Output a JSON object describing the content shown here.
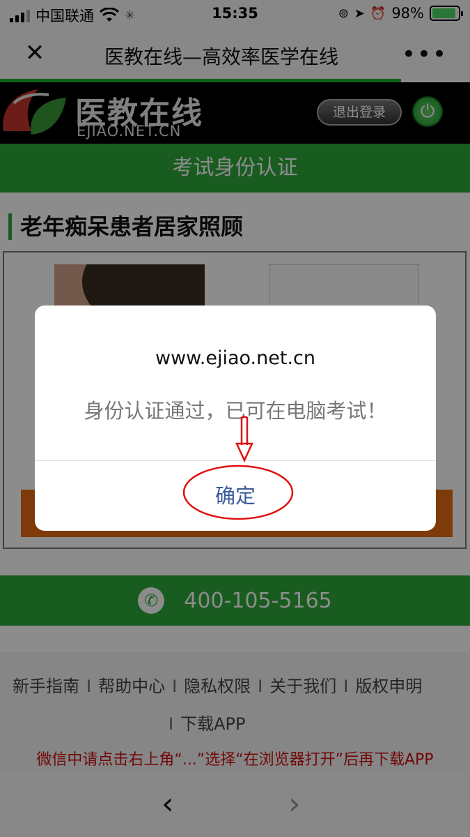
{
  "status_bar": {
    "carrier": "中国联通",
    "time": "15:35",
    "battery": "98%"
  },
  "title_bar": {
    "title": "医教在线—高效率医学在线",
    "close_icon": "close-icon",
    "more_icon": "more-icon"
  },
  "header": {
    "logo_cn": "医教在线",
    "logo_en": "EJIAO.NET.CN",
    "logout_label": "退出登录"
  },
  "banner": {
    "title": "考试身份认证"
  },
  "course": {
    "title": "老年痴呆患者居家照顾"
  },
  "contact": {
    "phone": "400-105-5165"
  },
  "footer": {
    "links": [
      "新手指南",
      "帮助中心",
      "隐私权限",
      "关于我们",
      "版权申明",
      "下载APP"
    ],
    "separator": "I",
    "note": "微信中请点击右上角“...”选择“在浏览器打开”后再下载APP"
  },
  "browser_nav": {
    "back": "‹",
    "forward": "›"
  },
  "dialog": {
    "title": "www.ejiao.net.cn",
    "message": "身份认证通过，已可在电脑考试！",
    "ok_label": "确定"
  },
  "colors": {
    "brand_green": "#2ea83b",
    "header_black": "#000000",
    "orange": "#e86a12",
    "link_blue": "#3b5a9b",
    "note_red": "#d01010",
    "annotation_red": "#e01010"
  }
}
